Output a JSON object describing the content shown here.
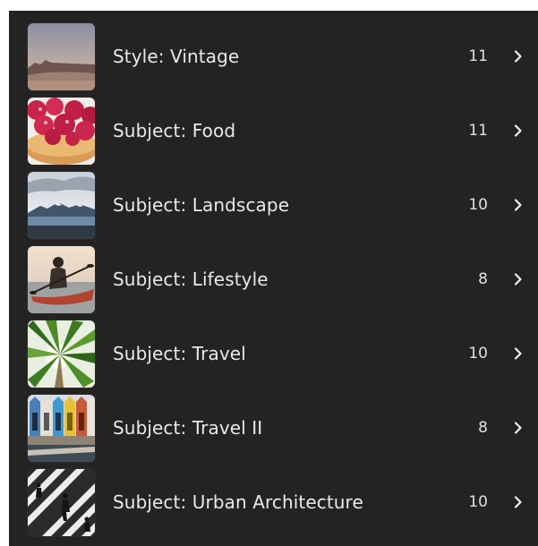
{
  "albums": [
    {
      "label": "Style: Vintage",
      "count": "11",
      "thumb": "vintage-desert-photo"
    },
    {
      "label": "Subject: Food",
      "count": "11",
      "thumb": "raspberry-tart-photo"
    },
    {
      "label": "Subject: Landscape",
      "count": "10",
      "thumb": "mountain-lake-photo"
    },
    {
      "label": "Subject: Lifestyle",
      "count": "8",
      "thumb": "kayaker-photo"
    },
    {
      "label": "Subject: Travel",
      "count": "10",
      "thumb": "palm-tree-photo"
    },
    {
      "label": "Subject: Travel II",
      "count": "8",
      "thumb": "beach-huts-photo"
    },
    {
      "label": "Subject: Urban Architecture",
      "count": "10",
      "thumb": "crosswalk-photo"
    }
  ],
  "colors": {
    "panel_bg": "#232323",
    "label_text": "#e9e9e9",
    "chevron": "#f0f0f0"
  },
  "icons": {
    "chevron": "chevron-right-icon"
  }
}
